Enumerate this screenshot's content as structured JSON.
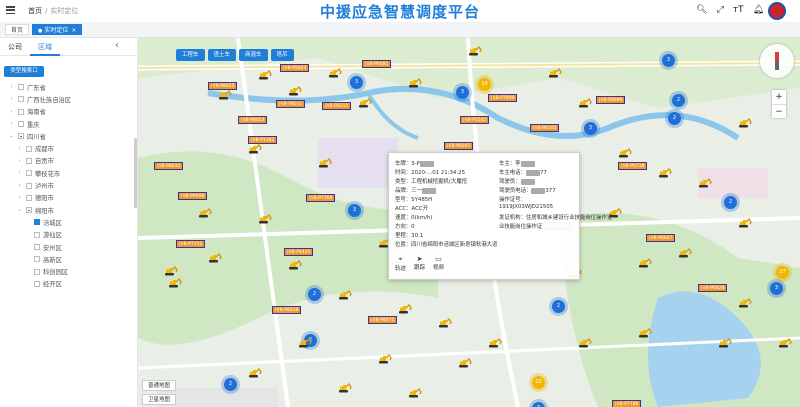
{
  "header": {
    "breadcrumb_home": "首页",
    "breadcrumb_current": "实时定位",
    "title": "中援应急智慧调度平台"
  },
  "tabs": [
    {
      "label": "首页"
    },
    {
      "label": "实时定位"
    }
  ],
  "sidebar": {
    "tab_company": "公司",
    "tab_region": "区域",
    "type_button": "类型搜索口",
    "tree": [
      {
        "label": "广东省",
        "level": 0,
        "state": "off",
        "arrow": "›"
      },
      {
        "label": "广西壮族自治区",
        "level": 0,
        "state": "off",
        "arrow": "›"
      },
      {
        "label": "海南省",
        "level": 0,
        "state": "off",
        "arrow": "›"
      },
      {
        "label": "重庆",
        "level": 0,
        "state": "off",
        "arrow": "›"
      },
      {
        "label": "四川省",
        "level": 0,
        "state": "half",
        "arrow": "⌄"
      },
      {
        "label": "成都市",
        "level": 1,
        "state": "off",
        "arrow": "›"
      },
      {
        "label": "自贡市",
        "level": 1,
        "state": "off",
        "arrow": "›"
      },
      {
        "label": "攀枝花市",
        "level": 1,
        "state": "off",
        "arrow": "›"
      },
      {
        "label": "泸州市",
        "level": 1,
        "state": "off",
        "arrow": "›"
      },
      {
        "label": "德阳市",
        "level": 1,
        "state": "off",
        "arrow": "›"
      },
      {
        "label": "绵阳市",
        "level": 1,
        "state": "half",
        "arrow": "⌄"
      },
      {
        "label": "涪城区",
        "level": 2,
        "state": "on",
        "arrow": ""
      },
      {
        "label": "游仙区",
        "level": 2,
        "state": "off",
        "arrow": ""
      },
      {
        "label": "安州区",
        "level": 2,
        "state": "off",
        "arrow": ""
      },
      {
        "label": "高新区",
        "level": 2,
        "state": "off",
        "arrow": ""
      },
      {
        "label": "科创园区",
        "level": 2,
        "state": "off",
        "arrow": ""
      },
      {
        "label": "经开区",
        "level": 2,
        "state": "off",
        "arrow": ""
      }
    ]
  },
  "map": {
    "buttons": [
      "工程车",
      "渣土车",
      "商混车",
      "塔吊"
    ],
    "map_types": [
      "普通地图",
      "卫星地图"
    ],
    "zoom_in": "+",
    "zoom_out": "−",
    "clusters": [
      "3",
      "14",
      "3",
      "3",
      "2",
      "3",
      "2",
      "3",
      "2",
      "27",
      "3",
      "2",
      "2",
      "2",
      "2",
      "22",
      "3"
    ],
    "labels": [
      "川B-P8055",
      "川B-P5023",
      "川B-P6681",
      "川B-P8011",
      "川B-P8053",
      "川B-P7009",
      "川B-P2211",
      "川B-P5542",
      "川B-P8089",
      "川B-P6001",
      "川B-P8102",
      "川B-P6718",
      "川B-P8032",
      "川B-P1162",
      "川B-P9006",
      "川B-P7760",
      "川B-P8081",
      "川B-P6667",
      "川B-P4425",
      "川B-P7151",
      "川B-P8218",
      "川B-P8071",
      "川B-P6628",
      "川B-P7788"
    ]
  },
  "popup": {
    "plate": "车牌：3-P",
    "time": "时间：2020-…01 21:34:25",
    "type": "类型：工程机械挖掘机(大履挖",
    "brand": "品牌：三一",
    "model": "型号：SY485H",
    "acc": "ACC：ACC开",
    "speed": "速度：0(km/h)",
    "direction": "方向：0",
    "mileage": "里程：30.1",
    "location": "位置：四川省绵阳市涪城区新皂镇秋港大道",
    "owner": "车主：李",
    "owner_phone": "车主电话：",
    "driver": "驾驶员：",
    "driver_phone": "驾驶员电话：",
    "license": "操作证号：",
    "license_no": "1919JX03WJD21505",
    "issuer": "发证机构：住房和城乡建设行业技能岗位操作证",
    "issuer_2": "业技能岗位操作证",
    "num_77": "77",
    "num_377": "377",
    "actions": [
      {
        "label": "轨迹",
        "icon": "location-pin-icon"
      },
      {
        "label": "跟踪",
        "icon": "navigate-icon"
      },
      {
        "label": "视频",
        "icon": "video-icon"
      }
    ]
  }
}
